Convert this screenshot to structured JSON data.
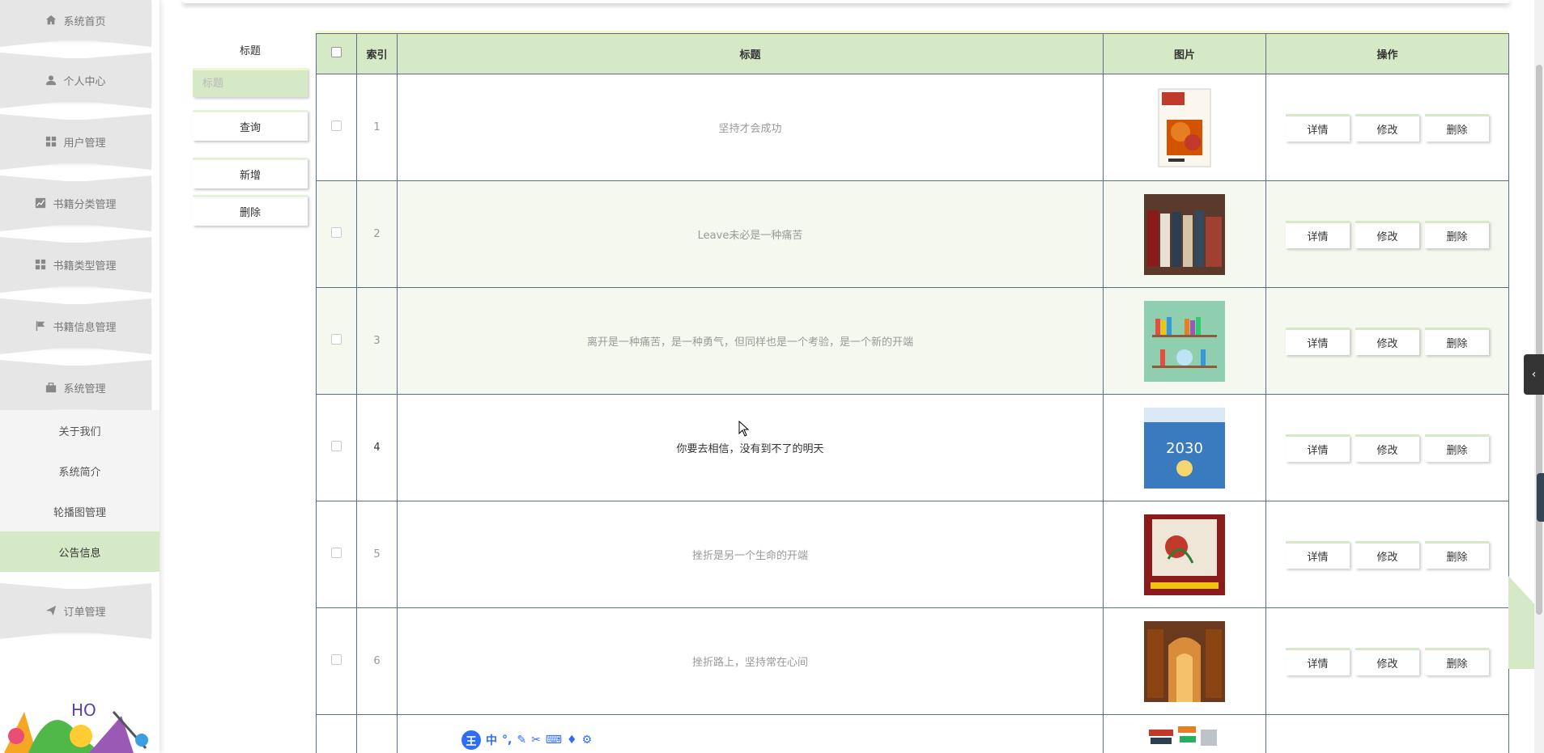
{
  "sidebar": {
    "menu": [
      {
        "label": "系统首页",
        "icon": "home-icon"
      },
      {
        "label": "个人中心",
        "icon": "person-icon"
      },
      {
        "label": "用户管理",
        "icon": "grid-icon"
      },
      {
        "label": "书籍分类管理",
        "icon": "chart-icon"
      },
      {
        "label": "书籍类型管理",
        "icon": "grid-icon"
      },
      {
        "label": "书籍信息管理",
        "icon": "flag-icon"
      },
      {
        "label": "系统管理",
        "icon": "briefcase-icon"
      }
    ],
    "submenu": [
      "关于我们",
      "系统简介",
      "轮播图管理",
      "公告信息"
    ],
    "submenu_active": "公告信息",
    "order_menu": {
      "label": "订单管理",
      "icon": "send-icon"
    },
    "mascot_text": "HO"
  },
  "search": {
    "label": "标题",
    "placeholder": "标题",
    "query_button": "查询",
    "add_button": "新增",
    "delete_button": "删除"
  },
  "table": {
    "headers": [
      "索引",
      "标题",
      "图片",
      "操作"
    ],
    "actions": {
      "detail": "详情",
      "edit": "修改",
      "delete": "删除"
    },
    "rows": [
      {
        "index": "1",
        "title": "坚持才会成功",
        "image": "magazine-cover"
      },
      {
        "index": "2",
        "title": "Leave未必是一种痛苦",
        "image": "bookshelf-photo"
      },
      {
        "index": "3",
        "title": "离开是一种痛苦，是一种勇气，但同样也是一个考验，是一个新的开端",
        "image": "bookshelf-illustration"
      },
      {
        "index": "4",
        "title": "你要去相信，没有到不了的明天",
        "image": "book-cover-trend"
      },
      {
        "index": "5",
        "title": "挫折是另一个生命的开端",
        "image": "book-cover-red"
      },
      {
        "index": "6",
        "title": "挫折路上，坚持常在心间",
        "image": "library-photo"
      }
    ],
    "hover_row": "4"
  },
  "ime_toolbar": {
    "logo": "王",
    "mode": "中"
  },
  "colors": {
    "accent_green": "#d6e9c6",
    "border": "#5a6e8a",
    "ime_blue": "#2f6df6"
  }
}
